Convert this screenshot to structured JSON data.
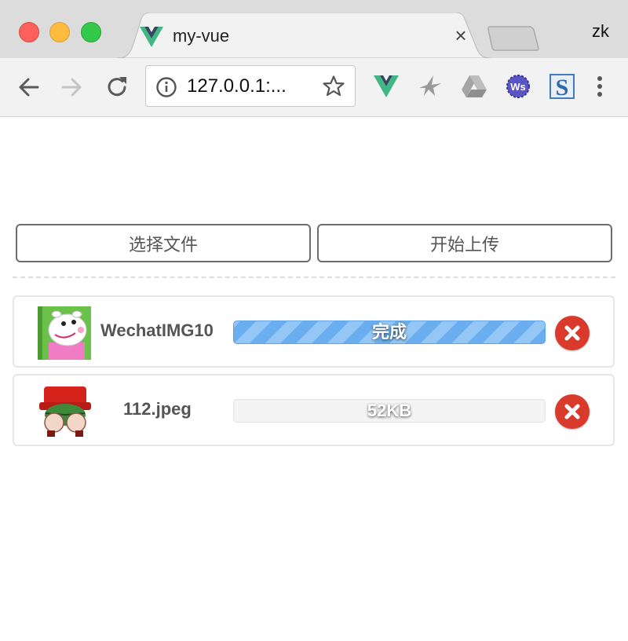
{
  "browser": {
    "tab_title": "my-vue",
    "tab_close": "×",
    "profile": "zk",
    "url": "127.0.0.1:...",
    "extensions": [
      "vue-devtools-icon",
      "bird-icon",
      "drive-icon",
      "ws-icon",
      "s-icon"
    ]
  },
  "actions": {
    "select_label": "选择文件",
    "upload_label": "开始上传"
  },
  "files": [
    {
      "name": "WechatIMG10",
      "status": "完成",
      "progress": 1.0,
      "state": "done",
      "thumb": "peppa-sheep-thumbnail"
    },
    {
      "name": "112.jpeg",
      "status": "52KB",
      "progress": 0.0,
      "state": "pending",
      "thumb": "red-hat-character-thumbnail"
    }
  ],
  "colors": {
    "progress_done": "#6aaef0",
    "remove_button": "#d93a2b"
  }
}
